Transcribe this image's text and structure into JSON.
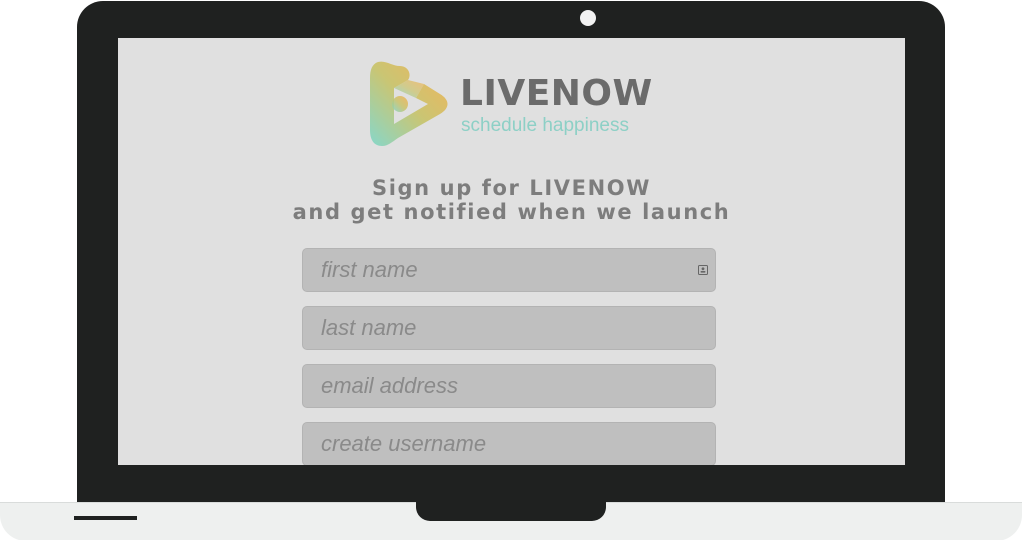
{
  "brand": {
    "name": "LIVENOW",
    "tagline": "schedule happiness",
    "colors": {
      "mark_gradient_start": "#f3b04f",
      "mark_gradient_mid": "#c8c36a",
      "mark_gradient_end": "#7fd6c8",
      "name_text": "#6b6b6b",
      "tagline_text": "#8dd0c6"
    }
  },
  "headline": {
    "line1": "Sign up for LIVENOW",
    "line2": "and get notified when we launch"
  },
  "form": {
    "first_name": {
      "placeholder": "first name",
      "value": "",
      "icon": "contact-card-icon"
    },
    "last_name": {
      "placeholder": "last name",
      "value": ""
    },
    "email": {
      "placeholder": "email address",
      "value": ""
    },
    "username": {
      "placeholder": "create username",
      "value": ""
    }
  },
  "device": {
    "frame": "laptop",
    "bezel_color": "#1f2120",
    "screen_background": "#e0e0e0"
  }
}
